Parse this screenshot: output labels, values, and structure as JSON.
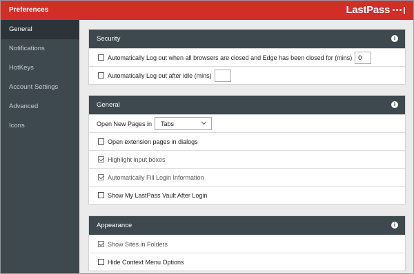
{
  "header": {
    "title": "Preferences",
    "logo_text": "LastPass"
  },
  "sidebar": {
    "items": [
      {
        "label": "General"
      },
      {
        "label": "Notifications"
      },
      {
        "label": "HotKeys"
      },
      {
        "label": "Account Settings"
      },
      {
        "label": "Advanced"
      },
      {
        "label": "Icons"
      }
    ]
  },
  "security": {
    "title": "Security",
    "auto_logout_browsers_label": "Automatically Log out when all browsers are closed and Edge has been closed for (mins)",
    "auto_logout_browsers_value": "0",
    "auto_logout_browsers_checked": false,
    "auto_logout_idle_label": "Automatically Log out after idle (mins)",
    "auto_logout_idle_value": "",
    "auto_logout_idle_checked": false
  },
  "general": {
    "title": "General",
    "open_new_pages_label": "Open New Pages in",
    "open_new_pages_value": "Tabs",
    "options": [
      {
        "label": "Open extension pages in dialogs",
        "checked": false
      },
      {
        "label": "Highlight input boxes",
        "checked": true
      },
      {
        "label": "Automatically Fill Login Information",
        "checked": true
      },
      {
        "label": "Show My LastPass Vault After Login",
        "checked": false
      }
    ]
  },
  "appearance": {
    "title": "Appearance",
    "options": [
      {
        "label": "Show Sites in Folders",
        "checked": true
      },
      {
        "label": "Hide Context Menu Options",
        "checked": false
      }
    ]
  },
  "colors": {
    "brand_red": "#d32d27",
    "sidebar_bg": "#3e484f",
    "sidebar_active": "#2c343a",
    "section_header": "#3e484f"
  },
  "icons": {
    "info": "info-icon",
    "dropdown": "chevron-down-icon",
    "logo_mark": "lastpass-dots-icon"
  }
}
